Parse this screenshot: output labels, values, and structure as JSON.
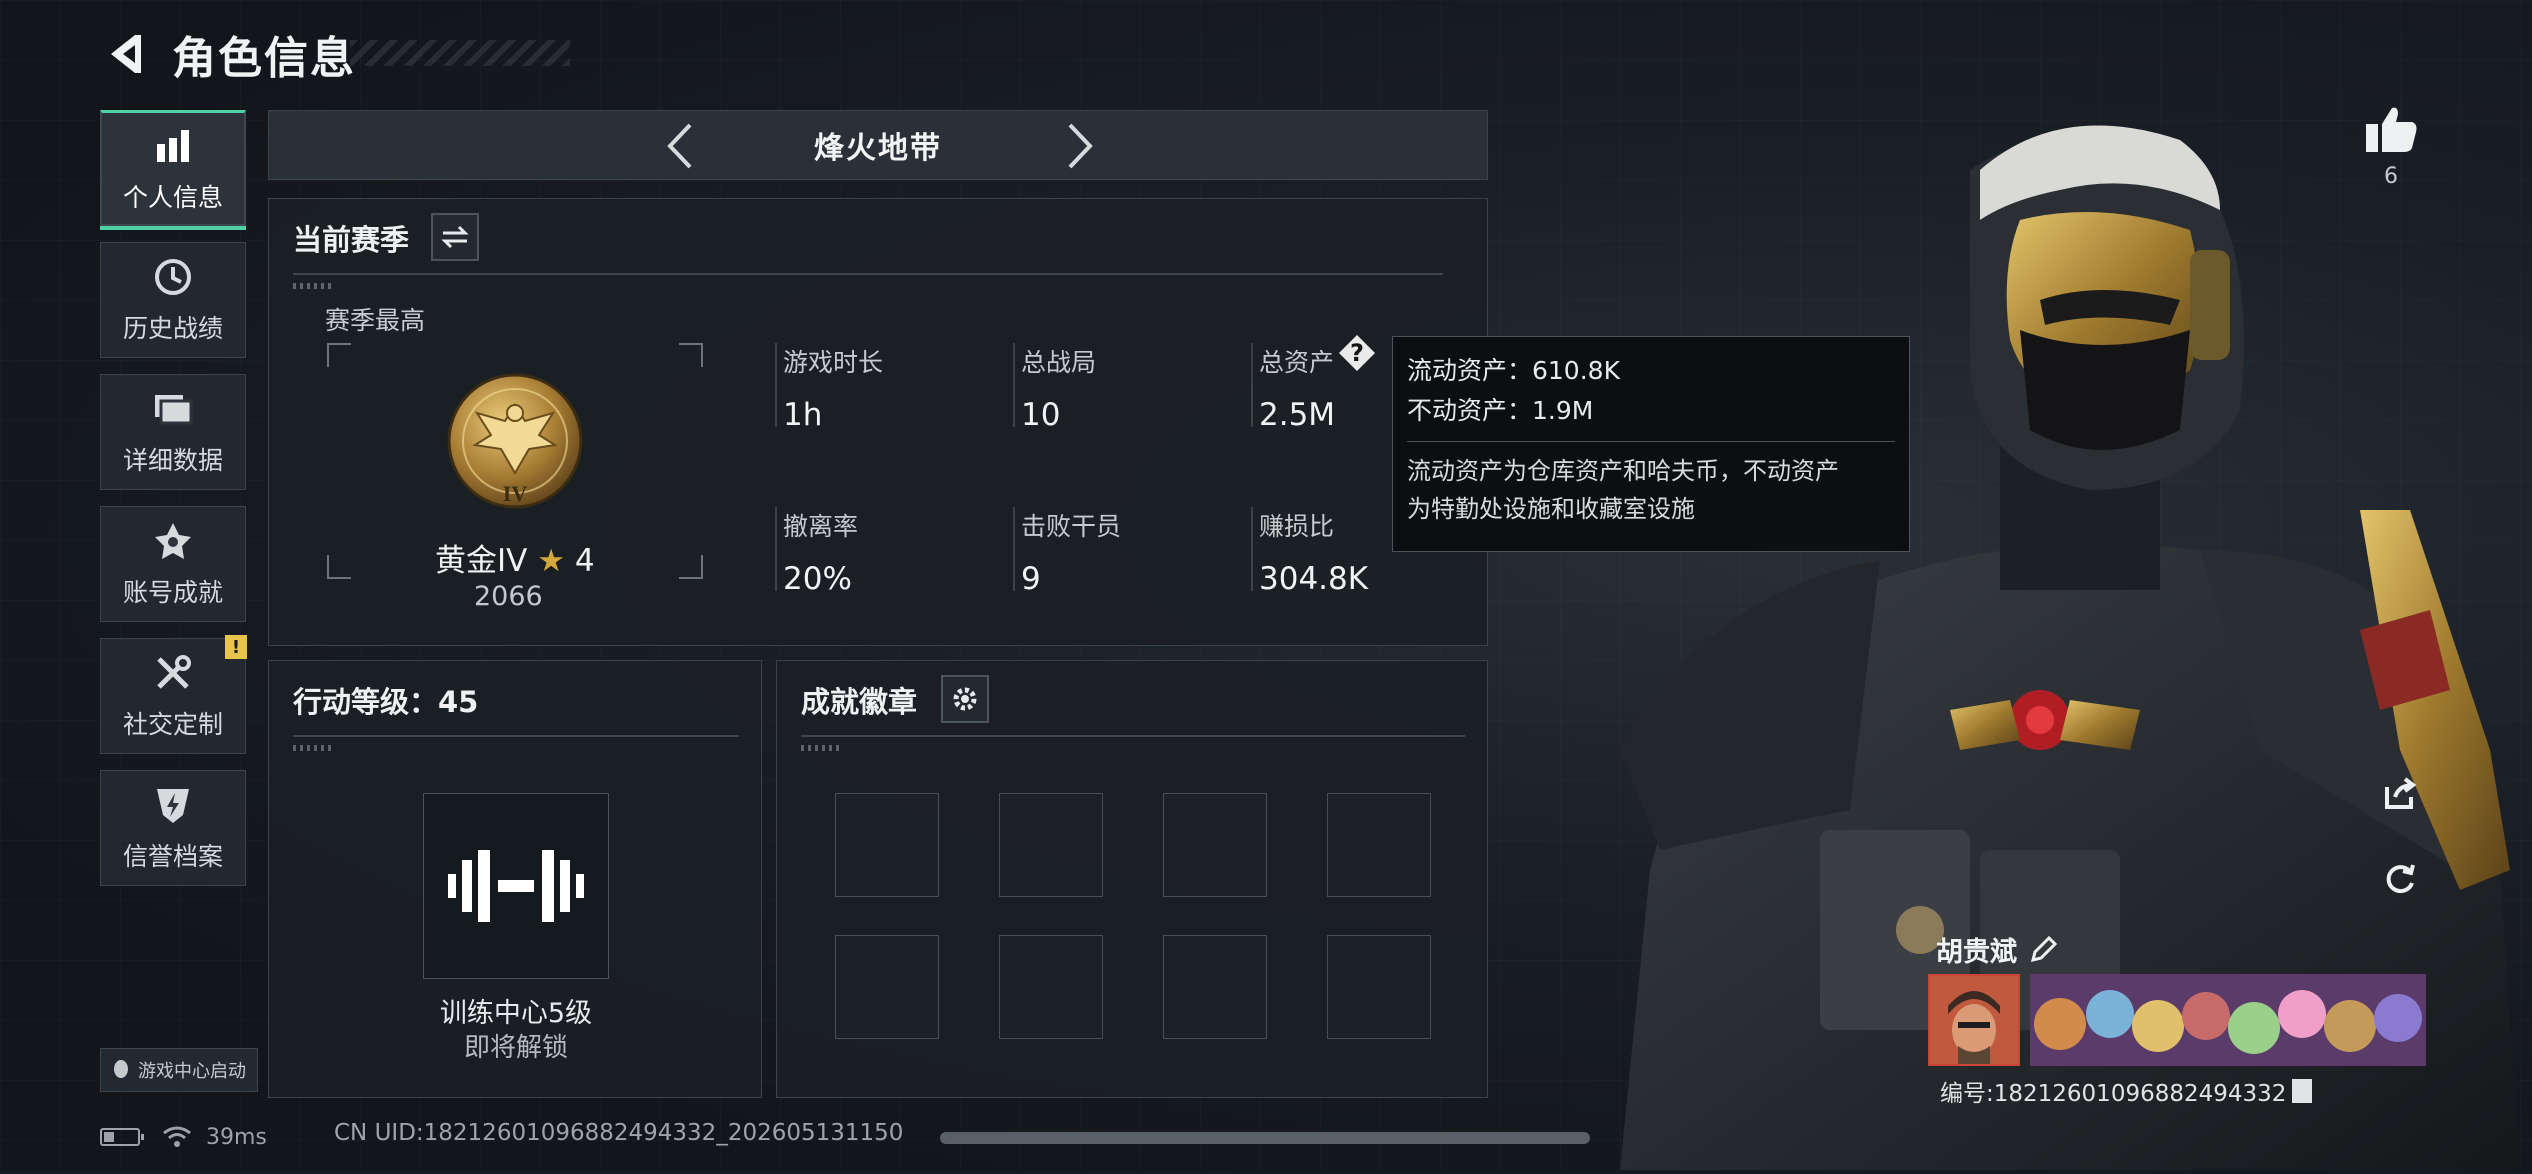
{
  "header": {
    "title": "角色信息"
  },
  "nav": {
    "items": [
      {
        "label": "个人信息",
        "icon": "bar-chart-icon",
        "active": true
      },
      {
        "label": "历史战绩",
        "icon": "clock-icon"
      },
      {
        "label": "详细数据",
        "icon": "folder-icon"
      },
      {
        "label": "账号成就",
        "icon": "achievement-star-icon"
      },
      {
        "label": "社交定制",
        "icon": "tools-icon",
        "badge": "!"
      },
      {
        "label": "信誉档案",
        "icon": "shield-lightning-icon"
      }
    ],
    "launch_label": "游戏中心启动"
  },
  "mode": {
    "name": "烽火地带"
  },
  "season": {
    "title": "当前赛季",
    "best_label": "赛季最高",
    "rank_name": "黄金IV",
    "rank_stars": "4",
    "rank_emblem_text": "IV",
    "rank_score": "2066",
    "stats": [
      {
        "label": "游戏时长",
        "value": "1h"
      },
      {
        "label": "总战局",
        "value": "10"
      },
      {
        "label": "总资产",
        "value": "2.5M"
      },
      {
        "label": "撤离率",
        "value": "20%"
      },
      {
        "label": "击败干员",
        "value": "9"
      },
      {
        "label": "赚损比",
        "value": "304.8K"
      }
    ],
    "help_icon": "?"
  },
  "tooltip": {
    "liquid": "流动资产：610.8K",
    "fixed": "不动资产：1.9M",
    "desc_line1": "流动资产为仓库资产和哈夫币，不动资产",
    "desc_line2": "为特勤处设施和收藏室设施"
  },
  "action": {
    "title": "行动等级：45",
    "training_name": "训练中心5级",
    "training_status": "即将解锁"
  },
  "badges": {
    "title": "成就徽章",
    "slots": 8
  },
  "status_bar": {
    "ping": "39ms",
    "uid": "CN UID:18212601096882494332_202605131150"
  },
  "player": {
    "name": "胡贵斌",
    "id_label": "编号:18212601096882494332"
  },
  "likes": {
    "count": "6"
  },
  "colors": {
    "accent": "#4fd1a5",
    "warning": "#e9c44a",
    "gold": "#c9a24a"
  }
}
